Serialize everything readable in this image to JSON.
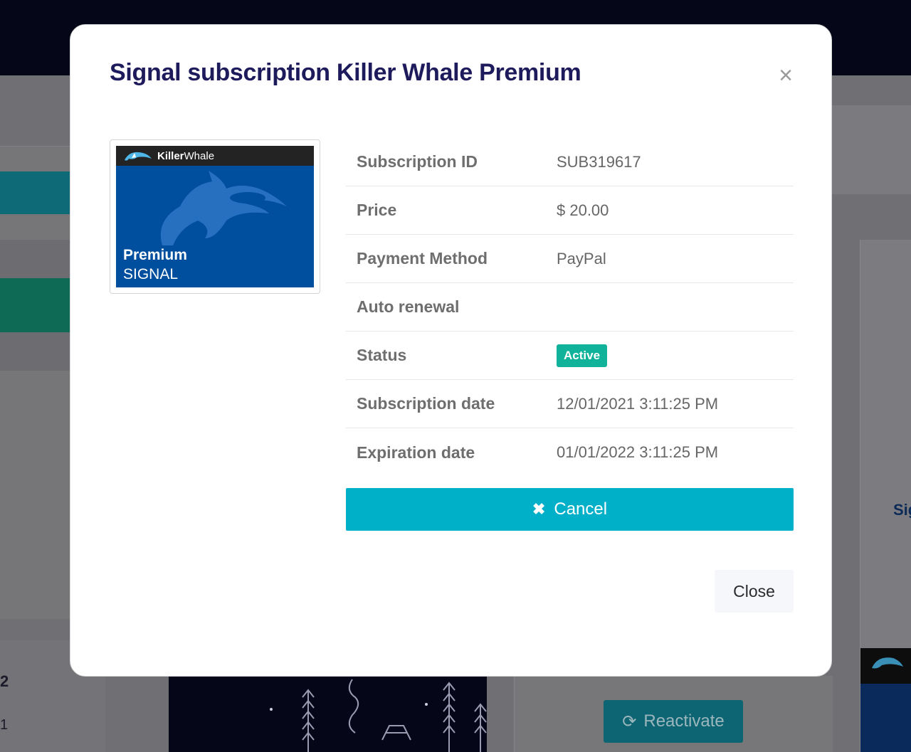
{
  "background": {
    "partial_sig": "Sig",
    "partial_num": "2",
    "partial_row": "1",
    "reactivate_label": "Reactivate"
  },
  "modal": {
    "title": "Signal subscription Killer Whale Premium",
    "close_x": "×",
    "thumbnail": {
      "brand_bold": "Killer",
      "brand_regular": "Whale",
      "line1": "Premium",
      "line2": "SIGNAL"
    },
    "details": [
      {
        "label": "Subscription ID",
        "value": "SUB319617"
      },
      {
        "label": "Price",
        "value": "$ 20.00"
      },
      {
        "label": "Payment Method",
        "value": "PayPal"
      },
      {
        "label": "Auto renewal",
        "value": ""
      },
      {
        "label": "Status",
        "value": "Active"
      },
      {
        "label": "Subscription date",
        "value": "12/01/2021 3:11:25 PM"
      },
      {
        "label": "Expiration date",
        "value": "01/01/2022 3:11:25 PM"
      }
    ],
    "cancel_icon": "✖",
    "cancel_label": "Cancel",
    "close_label": "Close"
  },
  "colors": {
    "title": "#1e1b5c",
    "accent": "#00b0c8",
    "status_active": "#11b29a",
    "thumb_blue": "#004f9e"
  }
}
